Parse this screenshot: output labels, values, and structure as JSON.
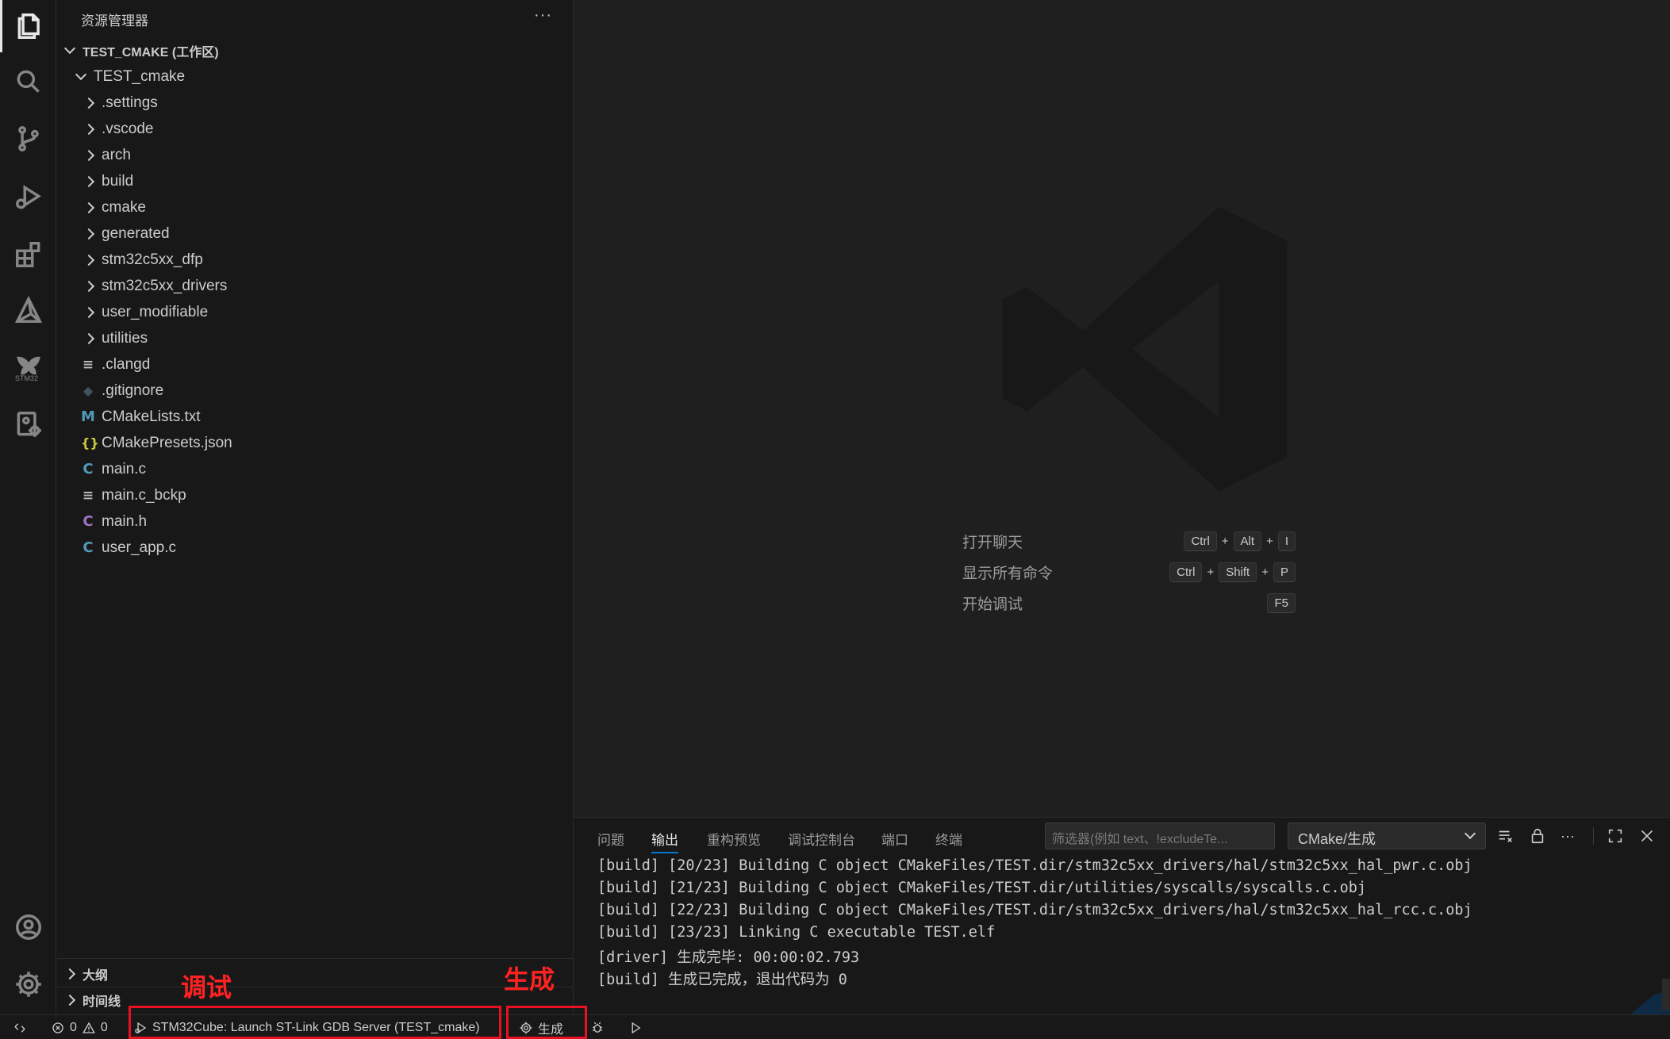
{
  "activity_bar": {
    "items": [
      "explorer-icon",
      "search-icon",
      "source-control-icon",
      "run-debug-icon",
      "extensions-icon",
      "cmake-icon",
      "stm32-icon",
      "remote-explorer-icon"
    ],
    "stm32_label": "STM32",
    "bottom": [
      "account-icon",
      "manage-gear-icon"
    ]
  },
  "sidebar": {
    "title": "资源管理器",
    "more": "···",
    "workspace": "TEST_CMAKE (工作区)",
    "root": "TEST_cmake",
    "folders": [
      ".settings",
      ".vscode",
      "arch",
      "build",
      "cmake",
      "generated",
      "stm32c5xx_dfp",
      "stm32c5xx_drivers",
      "user_modifiable",
      "utilities"
    ],
    "files": [
      {
        "name": ".clangd",
        "icon": "≡"
      },
      {
        "name": ".gitignore",
        "icon": "◆"
      },
      {
        "name": "CMakeLists.txt",
        "icon": "M"
      },
      {
        "name": "CMakePresets.json",
        "icon": "{}"
      },
      {
        "name": "main.c",
        "icon": "C"
      },
      {
        "name": "main.c_bckp",
        "icon": "≡"
      },
      {
        "name": "main.h",
        "icon": "C"
      },
      {
        "name": "user_app.c",
        "icon": "C"
      }
    ],
    "outline": "大纲",
    "timeline": "时间线"
  },
  "editor": {
    "shortcuts": [
      {
        "label": "打开聊天",
        "keys": [
          "Ctrl",
          "Alt",
          "I"
        ]
      },
      {
        "label": "显示所有命令",
        "keys": [
          "Ctrl",
          "Shift",
          "P"
        ]
      },
      {
        "label": "开始调试",
        "keys": [
          "F5"
        ]
      }
    ]
  },
  "panel": {
    "tabs": [
      "问题",
      "输出",
      "重构预览",
      "调试控制台",
      "端口",
      "终端"
    ],
    "active_tab": "输出",
    "filter_placeholder": "筛选器(例如 text、!excludeTe...",
    "channel": "CMake/生成",
    "output": [
      "[build] [20/23] Building C object CMakeFiles/TEST.dir/stm32c5xx_drivers/hal/stm32c5xx_hal_pwr.c.obj",
      "[build] [21/23] Building C object CMakeFiles/TEST.dir/utilities/syscalls/syscalls.c.obj",
      "[build] [22/23] Building C object CMakeFiles/TEST.dir/stm32c5xx_drivers/hal/stm32c5xx_hal_rcc.c.obj",
      "[build] [23/23] Linking C executable TEST.elf",
      "[driver] 生成完毕: 00:00:02.793",
      "[build] 生成已完成，退出代码为 0"
    ]
  },
  "statusbar": {
    "errors": "0",
    "warnings": "0",
    "launch": "STM32Cube: Launch ST-Link GDB Server (TEST_cmake)",
    "build": "生成"
  },
  "annotations": {
    "debug": "调试",
    "build": "生成",
    "color": "#e81123"
  }
}
